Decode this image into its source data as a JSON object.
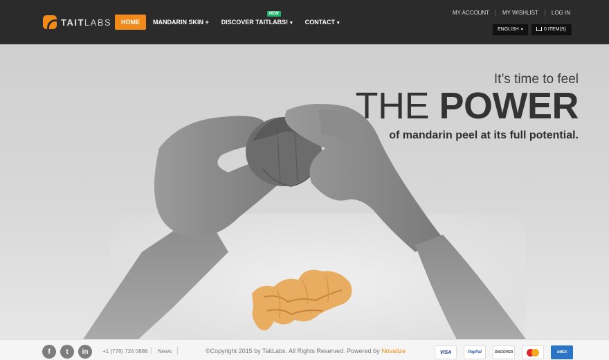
{
  "header": {
    "logo": {
      "strong": "TAIT",
      "light": "LABS"
    },
    "nav": [
      {
        "label": "HOME",
        "active": true
      },
      {
        "label": "MANDARIN SKIN +"
      },
      {
        "label": "DISCOVER TAITLABS!",
        "badge": "NEW",
        "chevron": "▾"
      },
      {
        "label": "CONTACT",
        "chevron": "▾"
      }
    ],
    "top_links": [
      "MY ACCOUNT",
      "MY WISHLIST",
      "LOG IN"
    ],
    "language": "ENGLISH",
    "cart": "0 ITEM(S)"
  },
  "hero": {
    "line1": "It’s time to feel",
    "line2_light": "THE ",
    "line2_bold": "POWER",
    "line3": "of mandarin peel at its full potential."
  },
  "footer": {
    "social": [
      {
        "icon": "facebook-icon",
        "glyph": "f"
      },
      {
        "icon": "twitter-icon",
        "glyph": "t"
      },
      {
        "icon": "linkedin-icon",
        "glyph": "in"
      }
    ],
    "phone": "+1 (778) 724 0886",
    "news": "News",
    "copyright": "©Copyright 2015 by TaitLabs. All Rights Reserved. Powered by ",
    "powered_by": "Novatize",
    "payments": [
      "VISA",
      "PayPal",
      "DISCOVER",
      "MasterCard",
      "AMERICAN EXPRESS"
    ]
  },
  "colors": {
    "accent": "#f28a1a",
    "header_bg": "#2b2b2b",
    "badge": "#1fb36b"
  }
}
